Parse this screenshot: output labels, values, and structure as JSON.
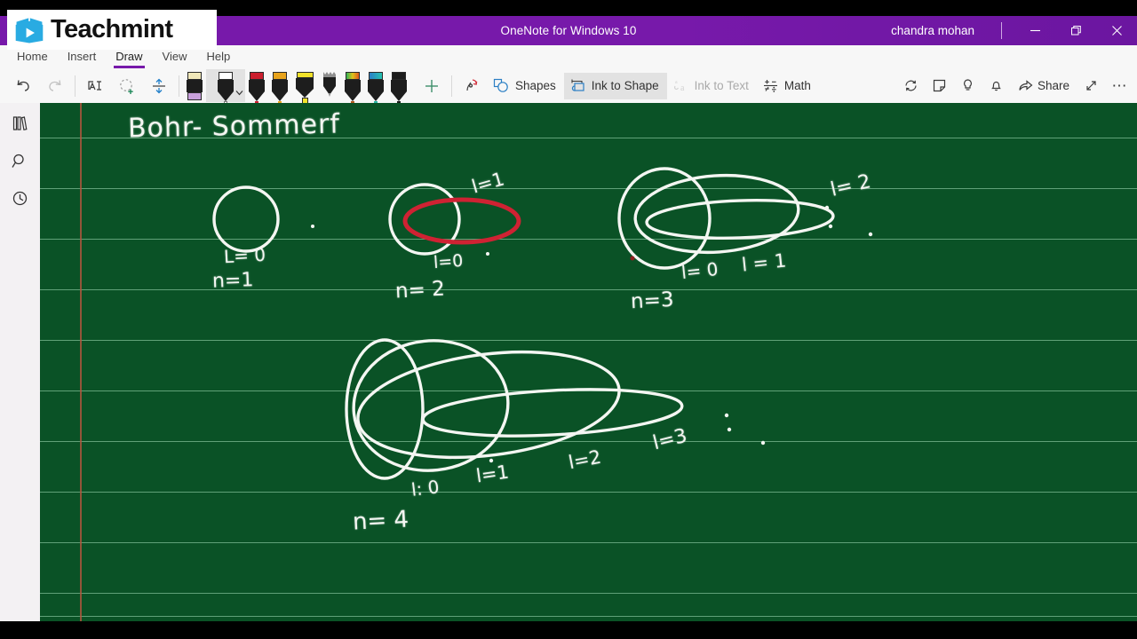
{
  "window": {
    "app_title": "OneNote for Windows 10",
    "user": "chandra mohan",
    "minimize": "—",
    "restore": "❐",
    "close": "✕"
  },
  "brand": {
    "name": "Teachmint",
    "logo_icon": "teachmint-book-play-logo",
    "accent": "#29ABE2"
  },
  "ribbon": {
    "tabs": [
      {
        "label": "Home",
        "active": false
      },
      {
        "label": "Insert",
        "active": false
      },
      {
        "label": "Draw",
        "active": true
      },
      {
        "label": "View",
        "active": false
      },
      {
        "label": "Help",
        "active": false
      }
    ],
    "undo": "undo-icon",
    "redo": "redo-icon",
    "lasso": "lasso-select-icon",
    "ink_select": "ink-select-icon",
    "space": "insert-space-icon",
    "pens": [
      {
        "name": "eraser",
        "cap": "#f0e7b9",
        "body": "#1d1d1d",
        "nib": "#c9a0dc",
        "type": "eraser",
        "selected": false
      },
      {
        "name": "pen-white",
        "cap": "#ffffff",
        "body": "#1d1d1d",
        "nib": "#ffffff",
        "type": "pen",
        "selected": true
      },
      {
        "name": "pen-red",
        "cap": "#cc1f2e",
        "body": "#1d1d1d",
        "nib": "#cc1f2e",
        "type": "pen",
        "selected": false
      },
      {
        "name": "pen-orange",
        "cap": "#e8a31c",
        "body": "#1d1d1d",
        "nib": "#e8a31c",
        "type": "pen",
        "selected": false
      },
      {
        "name": "highlighter-yellow",
        "cap": "#f2e22a",
        "body": "#1d1d1d",
        "nib": "#f2e22a",
        "type": "highlighter",
        "selected": false
      },
      {
        "name": "pencil-grey",
        "cap": "#8e8e8e",
        "body": "#1d1d1d",
        "nib": "#8e8e8e",
        "type": "pencil",
        "selected": false
      },
      {
        "name": "pen-rainbow",
        "cap": "#44bb55",
        "body": "#1d1d1d",
        "nib": "#b05a1e",
        "type": "pen",
        "selected": false
      },
      {
        "name": "pen-teal",
        "cap": "#2a7fc9",
        "body": "#1d1d1d",
        "nib": "#2ab5a5",
        "type": "pen",
        "selected": false
      },
      {
        "name": "pen-black",
        "cap": "#1d1d1d",
        "body": "#1d1d1d",
        "nib": "#1d1d1d",
        "type": "pen",
        "selected": false
      }
    ],
    "add_pen": "+",
    "ink_replay": "ink-replay-icon",
    "shapes_label": "Shapes",
    "ink_to_shape_label": "Ink to Shape",
    "ink_to_text_label": "Ink to Text",
    "math_label": "Math",
    "ink_to_shape_active": true,
    "ink_to_text_disabled": true,
    "right_tools": [
      {
        "name": "sync-icon",
        "label": ""
      },
      {
        "name": "sticky-note-icon",
        "label": ""
      },
      {
        "name": "lightbulb-icon",
        "label": ""
      },
      {
        "name": "bell-icon",
        "label": ""
      }
    ],
    "share_label": "Share",
    "expand": "expand-icon",
    "more": "⋯"
  },
  "rail": {
    "notebooks": "notebooks-icon",
    "search": "search-icon",
    "recent": "recent-clock-icon"
  },
  "canvas": {
    "background": "#0a5226",
    "rule_color": "#8fcda4",
    "margin_color": "#b5563f",
    "chalk_color": "#f4f6f2",
    "accent_red": "#cf2233",
    "title": "Bohr- Sommerf",
    "diagrams": [
      {
        "id": "n1",
        "n_label": "n=1",
        "orbit_labels": [
          "L= 0"
        ],
        "orbits": 1
      },
      {
        "id": "n2",
        "n_label": "n= 2",
        "orbit_labels": [
          "l=0",
          "l=1"
        ],
        "orbits": 2
      },
      {
        "id": "n3",
        "n_label": "n=3",
        "orbit_labels": [
          "l= 0",
          "l = 1",
          "l= 2"
        ],
        "orbits": 3
      },
      {
        "id": "n4",
        "n_label": "n= 4",
        "orbit_labels": [
          "l: 0",
          "l=1",
          "l=2",
          "l=3"
        ],
        "orbits": 4
      }
    ]
  }
}
